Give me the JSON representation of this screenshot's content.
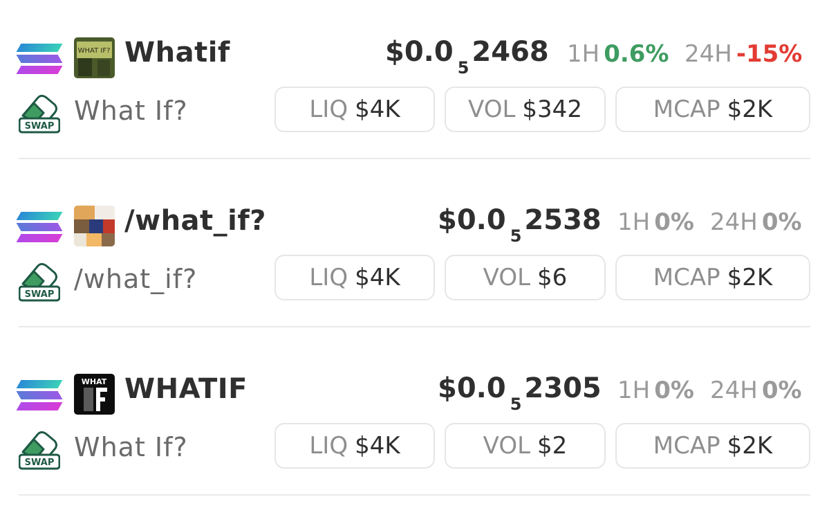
{
  "colors": {
    "positive": "#3f9c61",
    "negative": "#e23b33",
    "neutral": "#9a9a9a"
  },
  "tokens": [
    {
      "symbol": "Whatif",
      "name": "What If?",
      "price_prefix": "$0.0",
      "price_zeros": "5",
      "price_digits": "2468",
      "h1_label": "1H",
      "h1_value": "0.6%",
      "h1_trend": "positive",
      "h24_label": "24H",
      "h24_value": "-15%",
      "h24_trend": "negative",
      "liq_label": "LIQ",
      "liq_value": "$4K",
      "vol_label": "VOL",
      "vol_value": "$342",
      "mcap_label": "MCAP",
      "mcap_value": "$2K",
      "swap_label": "SWAP",
      "thumb_text": "WHAT IF?"
    },
    {
      "symbol": "/what_if?",
      "name": "/what_if?",
      "price_prefix": "$0.0",
      "price_zeros": "5",
      "price_digits": "2538",
      "h1_label": "1H",
      "h1_value": "0%",
      "h1_trend": "neutral",
      "h24_label": "24H",
      "h24_value": "0%",
      "h24_trend": "neutral",
      "liq_label": "LIQ",
      "liq_value": "$4K",
      "vol_label": "VOL",
      "vol_value": "$6",
      "mcap_label": "MCAP",
      "mcap_value": "$2K",
      "swap_label": "SWAP"
    },
    {
      "symbol": "WHATIF",
      "name": "What If?",
      "price_prefix": "$0.0",
      "price_zeros": "5",
      "price_digits": "2305",
      "h1_label": "1H",
      "h1_value": "0%",
      "h1_trend": "neutral",
      "h24_label": "24H",
      "h24_value": "0%",
      "h24_trend": "neutral",
      "liq_label": "LIQ",
      "liq_value": "$4K",
      "vol_label": "VOL",
      "vol_value": "$2",
      "mcap_label": "MCAP",
      "mcap_value": "$2K",
      "swap_label": "SWAP",
      "thumb_text": "WHAT"
    }
  ]
}
